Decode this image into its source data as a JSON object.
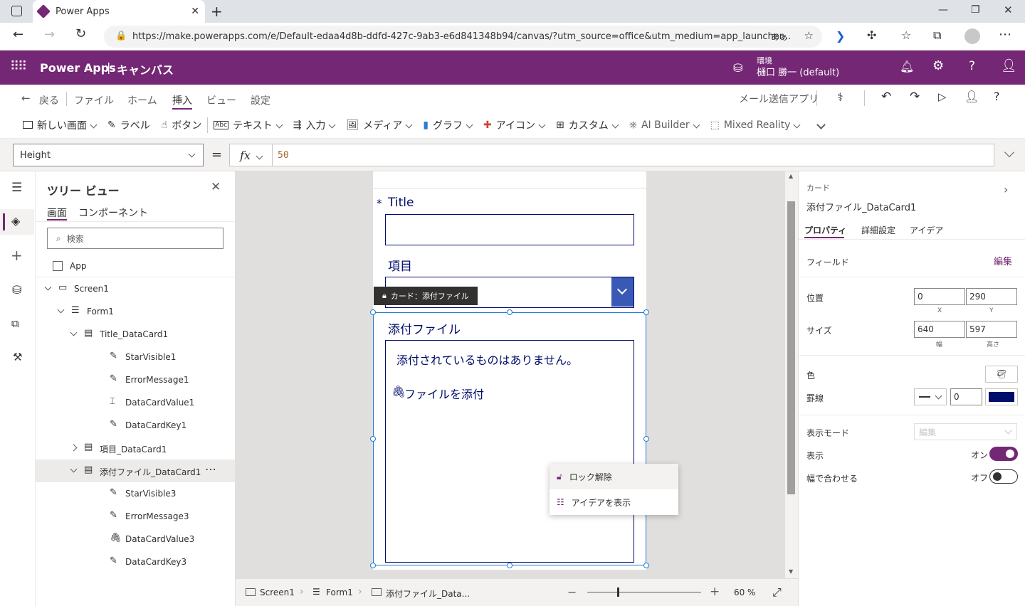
{
  "browser": {
    "tab_title": "Power Apps",
    "url": "https://make.powerapps.com/e/Default-edaa4d8b-ddfd-427c-9ab3-e6d841348b94/canvas/?utm_source=office&utm_medium=app_launcher...",
    "reader_label": "あぁ"
  },
  "header": {
    "app_name": "Power Apps",
    "separator": "|",
    "section": "キャンバス",
    "env_label": "環境",
    "env_name": "樋口 勝一 (default)"
  },
  "menu": {
    "back": "戻る",
    "items": [
      "ファイル",
      "ホーム",
      "挿入",
      "ビュー",
      "設定"
    ],
    "active": "挿入",
    "app_name": "メール送信アプリ"
  },
  "insert_toolbar": [
    "新しい画面",
    "ラベル",
    "ボタン",
    "テキスト",
    "入力",
    "メディア",
    "グラフ",
    "アイコン",
    "カスタム",
    "AI Builder",
    "Mixed Reality"
  ],
  "formula": {
    "property": "Height",
    "equals": "=",
    "fx": "fx",
    "value": "50"
  },
  "tree": {
    "title": "ツリー ビュー",
    "tabs": [
      "画面",
      "コンポーネント"
    ],
    "search_placeholder": "検索",
    "app": "App",
    "items": [
      {
        "label": "Screen1",
        "icon": "screen-icon"
      },
      {
        "label": "Form1",
        "icon": "form-icon"
      },
      {
        "label": "Title_DataCard1",
        "icon": "card-icon"
      },
      {
        "label": "StarVisible1",
        "icon": "edit-icon"
      },
      {
        "label": "ErrorMessage1",
        "icon": "edit-icon"
      },
      {
        "label": "DataCardValue1",
        "icon": "textinput-icon"
      },
      {
        "label": "DataCardKey1",
        "icon": "edit-icon"
      },
      {
        "label": "項目_DataCard1",
        "icon": "card-icon"
      },
      {
        "label": "添付ファイル_DataCard1",
        "icon": "card-icon"
      },
      {
        "label": "StarVisible3",
        "icon": "edit-icon"
      },
      {
        "label": "ErrorMessage3",
        "icon": "edit-icon"
      },
      {
        "label": "DataCardValue3",
        "icon": "attachment-icon"
      },
      {
        "label": "DataCardKey3",
        "icon": "edit-icon"
      }
    ]
  },
  "canvas": {
    "title_star": "*",
    "title_label": "Title",
    "item_label": "項目",
    "badge": "カード：添付ファイル",
    "attach_label": "添付ファイル",
    "attach_empty": "添付されているものはありません。",
    "attach_add": "ファイルを添付",
    "context_menu": [
      "ロック解除",
      "アイデアを表示"
    ]
  },
  "right_panel": {
    "kind": "カード",
    "name": "添付ファイル_DataCard1",
    "tabs": [
      "プロパティ",
      "詳細設定",
      "アイデア"
    ],
    "field_label": "フィールド",
    "edit": "編集",
    "position_label": "位置",
    "x": "0",
    "y": "290",
    "x_cap": "X",
    "y_cap": "Y",
    "size_label": "サイズ",
    "w": "640",
    "h": "597",
    "w_cap": "幅",
    "h_cap": "高さ",
    "color_label": "色",
    "border_label": "罫線",
    "border_width": "0",
    "border_color": "#000d6b",
    "display_mode_label": "表示モード",
    "display_mode": "編集",
    "visible_label": "表示",
    "visible_state": "オン",
    "fit_label": "幅で合わせる",
    "fit_state": "オフ"
  },
  "status": {
    "crumbs": [
      "Screen1",
      "Form1",
      "添付ファイル_Data..."
    ],
    "zoom": "60",
    "zoom_unit": "%"
  },
  "colors": {
    "brand": "#742774",
    "selection": "#1a7dd6",
    "dropdown": "#3a58b5"
  }
}
